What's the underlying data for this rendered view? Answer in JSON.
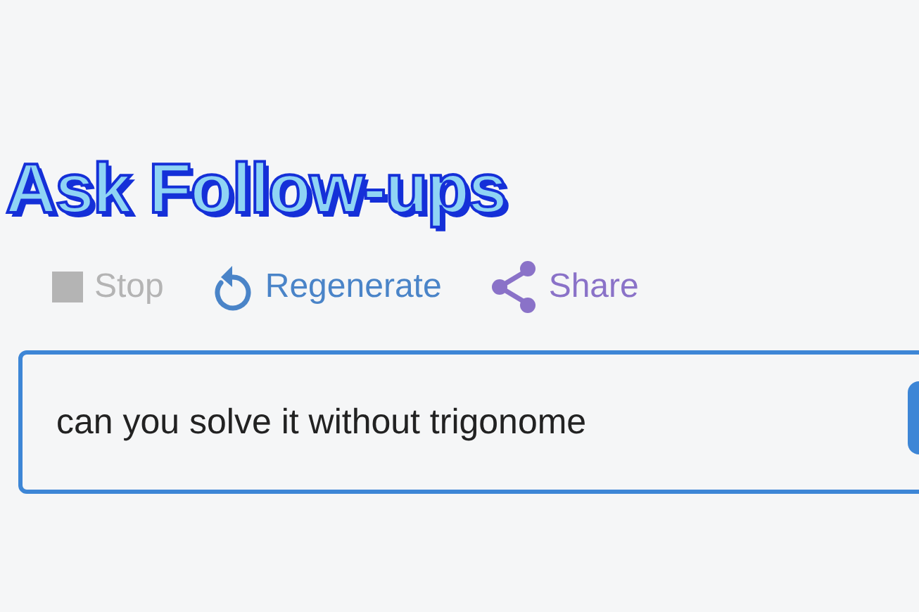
{
  "heading": "Ask Follow-ups",
  "actions": [
    {
      "kind": "stop",
      "label": "Stop",
      "disabled": true
    },
    {
      "kind": "regenerate",
      "label": "Regenerate",
      "disabled": false,
      "color": "#4a84c8"
    },
    {
      "kind": "share",
      "label": "Share",
      "disabled": false,
      "color": "#8a72c8"
    }
  ],
  "input": {
    "value": "can you solve it without trigonome"
  }
}
